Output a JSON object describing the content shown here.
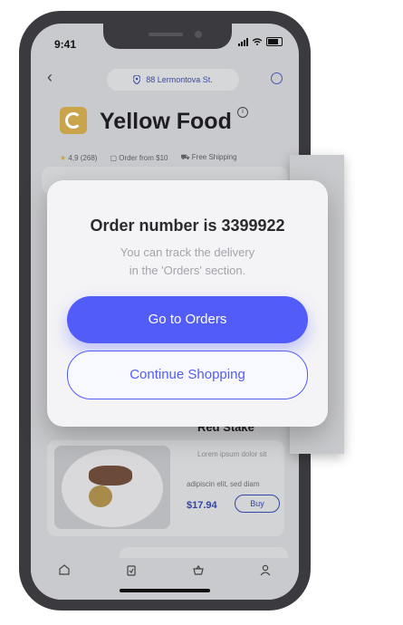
{
  "status_bar": {
    "time": "9:41"
  },
  "header": {
    "address": "88 Lermontova St.",
    "restaurant_name": "Yellow Food",
    "rating": "4,9 (268)",
    "order_min": "Order from $10",
    "shipping": "Free Shipping"
  },
  "product": {
    "title": "Red Stake",
    "desc_line1": "Lorem ipsum dolor sit",
    "desc_line2": "adipiscin elit, sed diam",
    "price": "$17.94",
    "buy_label": "Buy"
  },
  "modal": {
    "title": "Order number is 3399922",
    "subtitle_line1": "You can track the delivery",
    "subtitle_line2": "in the 'Orders' section.",
    "primary_label": "Go to Orders",
    "secondary_label": "Continue Shopping"
  },
  "tabbar": {
    "items": [
      "home-icon",
      "orders-icon",
      "basket-icon",
      "profile-icon"
    ]
  },
  "colors": {
    "accent": "#525cf9",
    "brand": "#c9a44a",
    "modal_bg": "#f4f4f6"
  }
}
